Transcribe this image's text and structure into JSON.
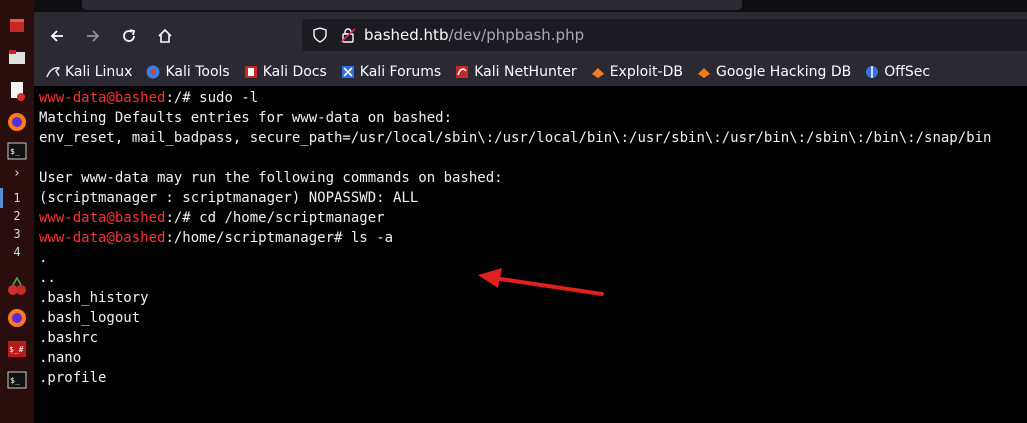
{
  "browser": {
    "url_host": "bashed.htb",
    "url_path": "/dev/phpbash.php"
  },
  "bookmarks": [
    {
      "label": "Kali Linux",
      "icon": "kali-dragon-icon"
    },
    {
      "label": "Kali Tools",
      "icon": "kali-tools-icon"
    },
    {
      "label": "Kali Docs",
      "icon": "kali-docs-icon"
    },
    {
      "label": "Kali Forums",
      "icon": "kali-forums-icon"
    },
    {
      "label": "Kali NetHunter",
      "icon": "kali-nethunter-icon"
    },
    {
      "label": "Exploit-DB",
      "icon": "exploit-db-icon"
    },
    {
      "label": "Google Hacking DB",
      "icon": "ghdb-icon"
    },
    {
      "label": "OffSec",
      "icon": "offsec-icon"
    }
  ],
  "taskbar": {
    "workspaces": [
      "1",
      "2",
      "3",
      "4"
    ]
  },
  "terminal": {
    "lines": [
      {
        "prompt": "www-data@bashed",
        "text": ":/# sudo -l"
      },
      {
        "prompt": "",
        "text": "Matching Defaults entries for www-data on bashed:"
      },
      {
        "prompt": "",
        "text": "env_reset, mail_badpass, secure_path=/usr/local/sbin\\:/usr/local/bin\\:/usr/sbin\\:/usr/bin\\:/sbin\\:/bin\\:/snap/bin"
      },
      {
        "prompt": "",
        "text": ""
      },
      {
        "prompt": "",
        "text": "User www-data may run the following commands on bashed:"
      },
      {
        "prompt": "",
        "text": "(scriptmanager : scriptmanager) NOPASSWD: ALL"
      },
      {
        "prompt": "www-data@bashed",
        "text": ":/# cd /home/scriptmanager"
      },
      {
        "prompt": "www-data@bashed",
        "text": ":/home/scriptmanager# ls -a"
      },
      {
        "prompt": "",
        "text": "."
      },
      {
        "prompt": "",
        "text": ".."
      },
      {
        "prompt": "",
        "text": ".bash_history"
      },
      {
        "prompt": "",
        "text": ".bash_logout"
      },
      {
        "prompt": "",
        "text": ".bashrc"
      },
      {
        "prompt": "",
        "text": ".nano"
      },
      {
        "prompt": "",
        "text": ".profile"
      }
    ]
  },
  "colors": {
    "prompt": "#ff3030",
    "arrow": "#e0201c"
  }
}
